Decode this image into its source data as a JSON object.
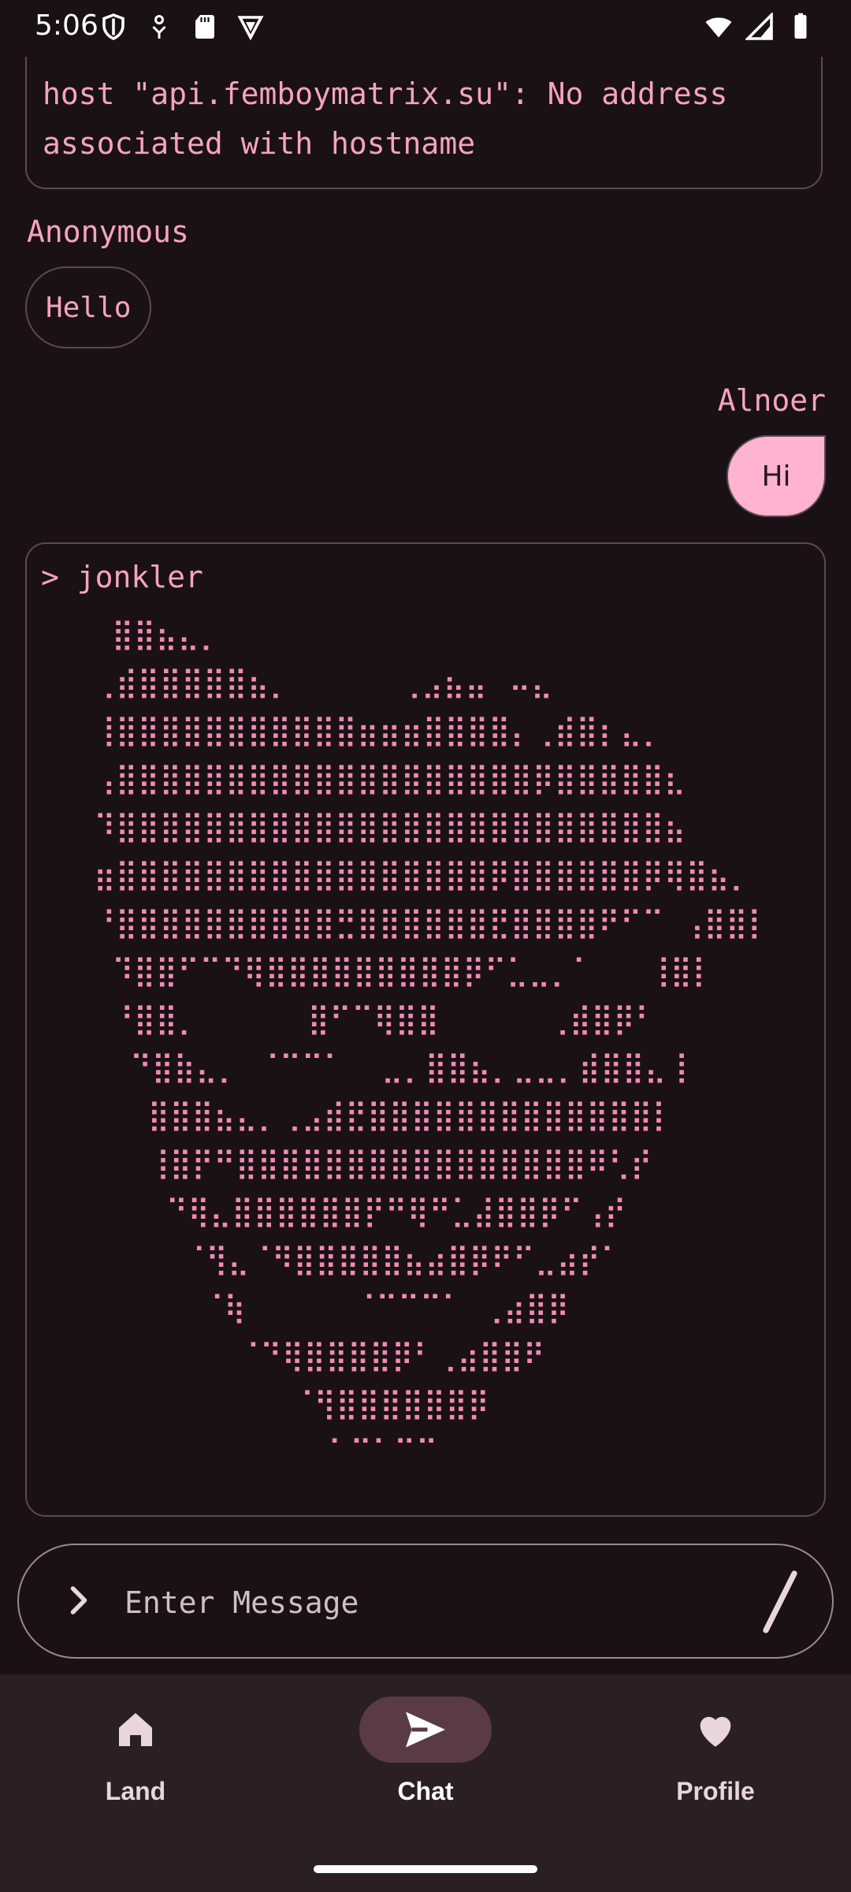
{
  "status_bar": {
    "time": "5:06"
  },
  "messages": {
    "error_text": "host \"api.femboymatrix.su\": No address associated with hostname",
    "anon": {
      "sender": "Anonymous",
      "text": "Hello"
    },
    "me": {
      "sender": "Alnoer",
      "text": "Hi"
    },
    "command": {
      "title": "> jonkler",
      "ascii": "  ⣿⣿⣦⣄⡀\n ⢀⣾⣿⣿⣿⣿⣿⣦⡀      ⢀⣠⣦⣤⠀⠤⣄\n ⢸⣿⣿⣿⣿⣿⣿⣿⣿⣿⣿⣿⣶⣶⣶⣿⣿⣿⣿⡄⢀⣾⣿⡆⣄⡀\n ⢠⣿⣿⣿⣿⣿⣿⣿⣿⣿⣿⣿⣿⣿⣿⣿⣿⣿⣿⣿⡿⣿⣿⣿⣿⣿⣆\n ⠹⣿⣿⣿⣿⣿⣿⣿⣿⣿⣿⣿⣿⣿⣿⣿⣿⣿⣿⣿⣿⣿⣿⣿⣿⣿⣦\n ⣶⣿⣿⣿⣿⣿⣿⣿⣿⣿⣿⣿⣿⣿⣿⣿⣿⣿⡿⣿⣿⣿⣿⣿⣿⡿⢿⣿⣦⡀\n ⠘⣿⣿⣿⣿⣿⣿⣿⣿⣿⣿⣛⣿⣿⣿⣿⣿⣿⣟⣿⣿⣿⣿⠟⠋⠉ ⢠⣿⣿⡇\n  ⠹⣿⣿⠋⠉⠙⢿⣿⣿⣿⣿⣿⣿⣿⣿⣿⡿⠋⣁⣀⡀⠁   ⢸⣿⡇\n  ⠘⣿⣿⡀      ⣿⠋⠉⢿⣿⣿      ⢀⣾⣿⡿⠃\n   ⠙⣿⣷⣄⡀ ⠈⠉⠉⠁  ⣀⡀⣿⣿⣦⡀⣀⣀⡀⣾⣿⣿⣄⢸\n    ⣿⣿⣿⣦⣄⡀⢀⣠⣾⣟⣿⣿⣿⣿⣿⣿⣿⣿⣿⣿⣿⣿⣿⡇\n    ⢸⣿⡟⠛⣿⣿⣿⣿⣿⣿⣿⣿⣿⣿⣿⣿⣿⣿⣿⣿⠿⢃⡞\n     ⠙⢿⣄⣿⣿⣿⣿⣿⣿⡟⠛⢿⠛⣁⣼⣿⣿⡿⠋⢠⡞\n      ⠈⢻⣄⠈⠻⣿⣿⣿⣿⣿⣦⣴⣿⡿⠟⠋⣀⣴⡞⠁\n       ⠈⢷      ⠈⠉⠉⠉⠁ ⢀⣴⣿⡿\n         ⠈⠙⢿⣿⣿⣿⣿⡿⠃⢀⣴⣿⣿⠟\n            ⠈⢻⣿⣿⣿⣿⣿⣿⡿\n              ⠁⠉⠁⠉⠉"
    }
  },
  "composer": {
    "placeholder": "Enter Message"
  },
  "nav": {
    "items": [
      {
        "label": "Land",
        "icon": "home-icon"
      },
      {
        "label": "Chat",
        "icon": "send-icon"
      },
      {
        "label": "Profile",
        "icon": "heart-icon"
      }
    ],
    "active": "Chat"
  },
  "colors": {
    "background": "#1a1114",
    "accent_text": "#f5a3c0",
    "my_bubble": "#ffb3cf",
    "nav_background": "#2a2024",
    "nav_active_pill": "#5a3a44"
  }
}
